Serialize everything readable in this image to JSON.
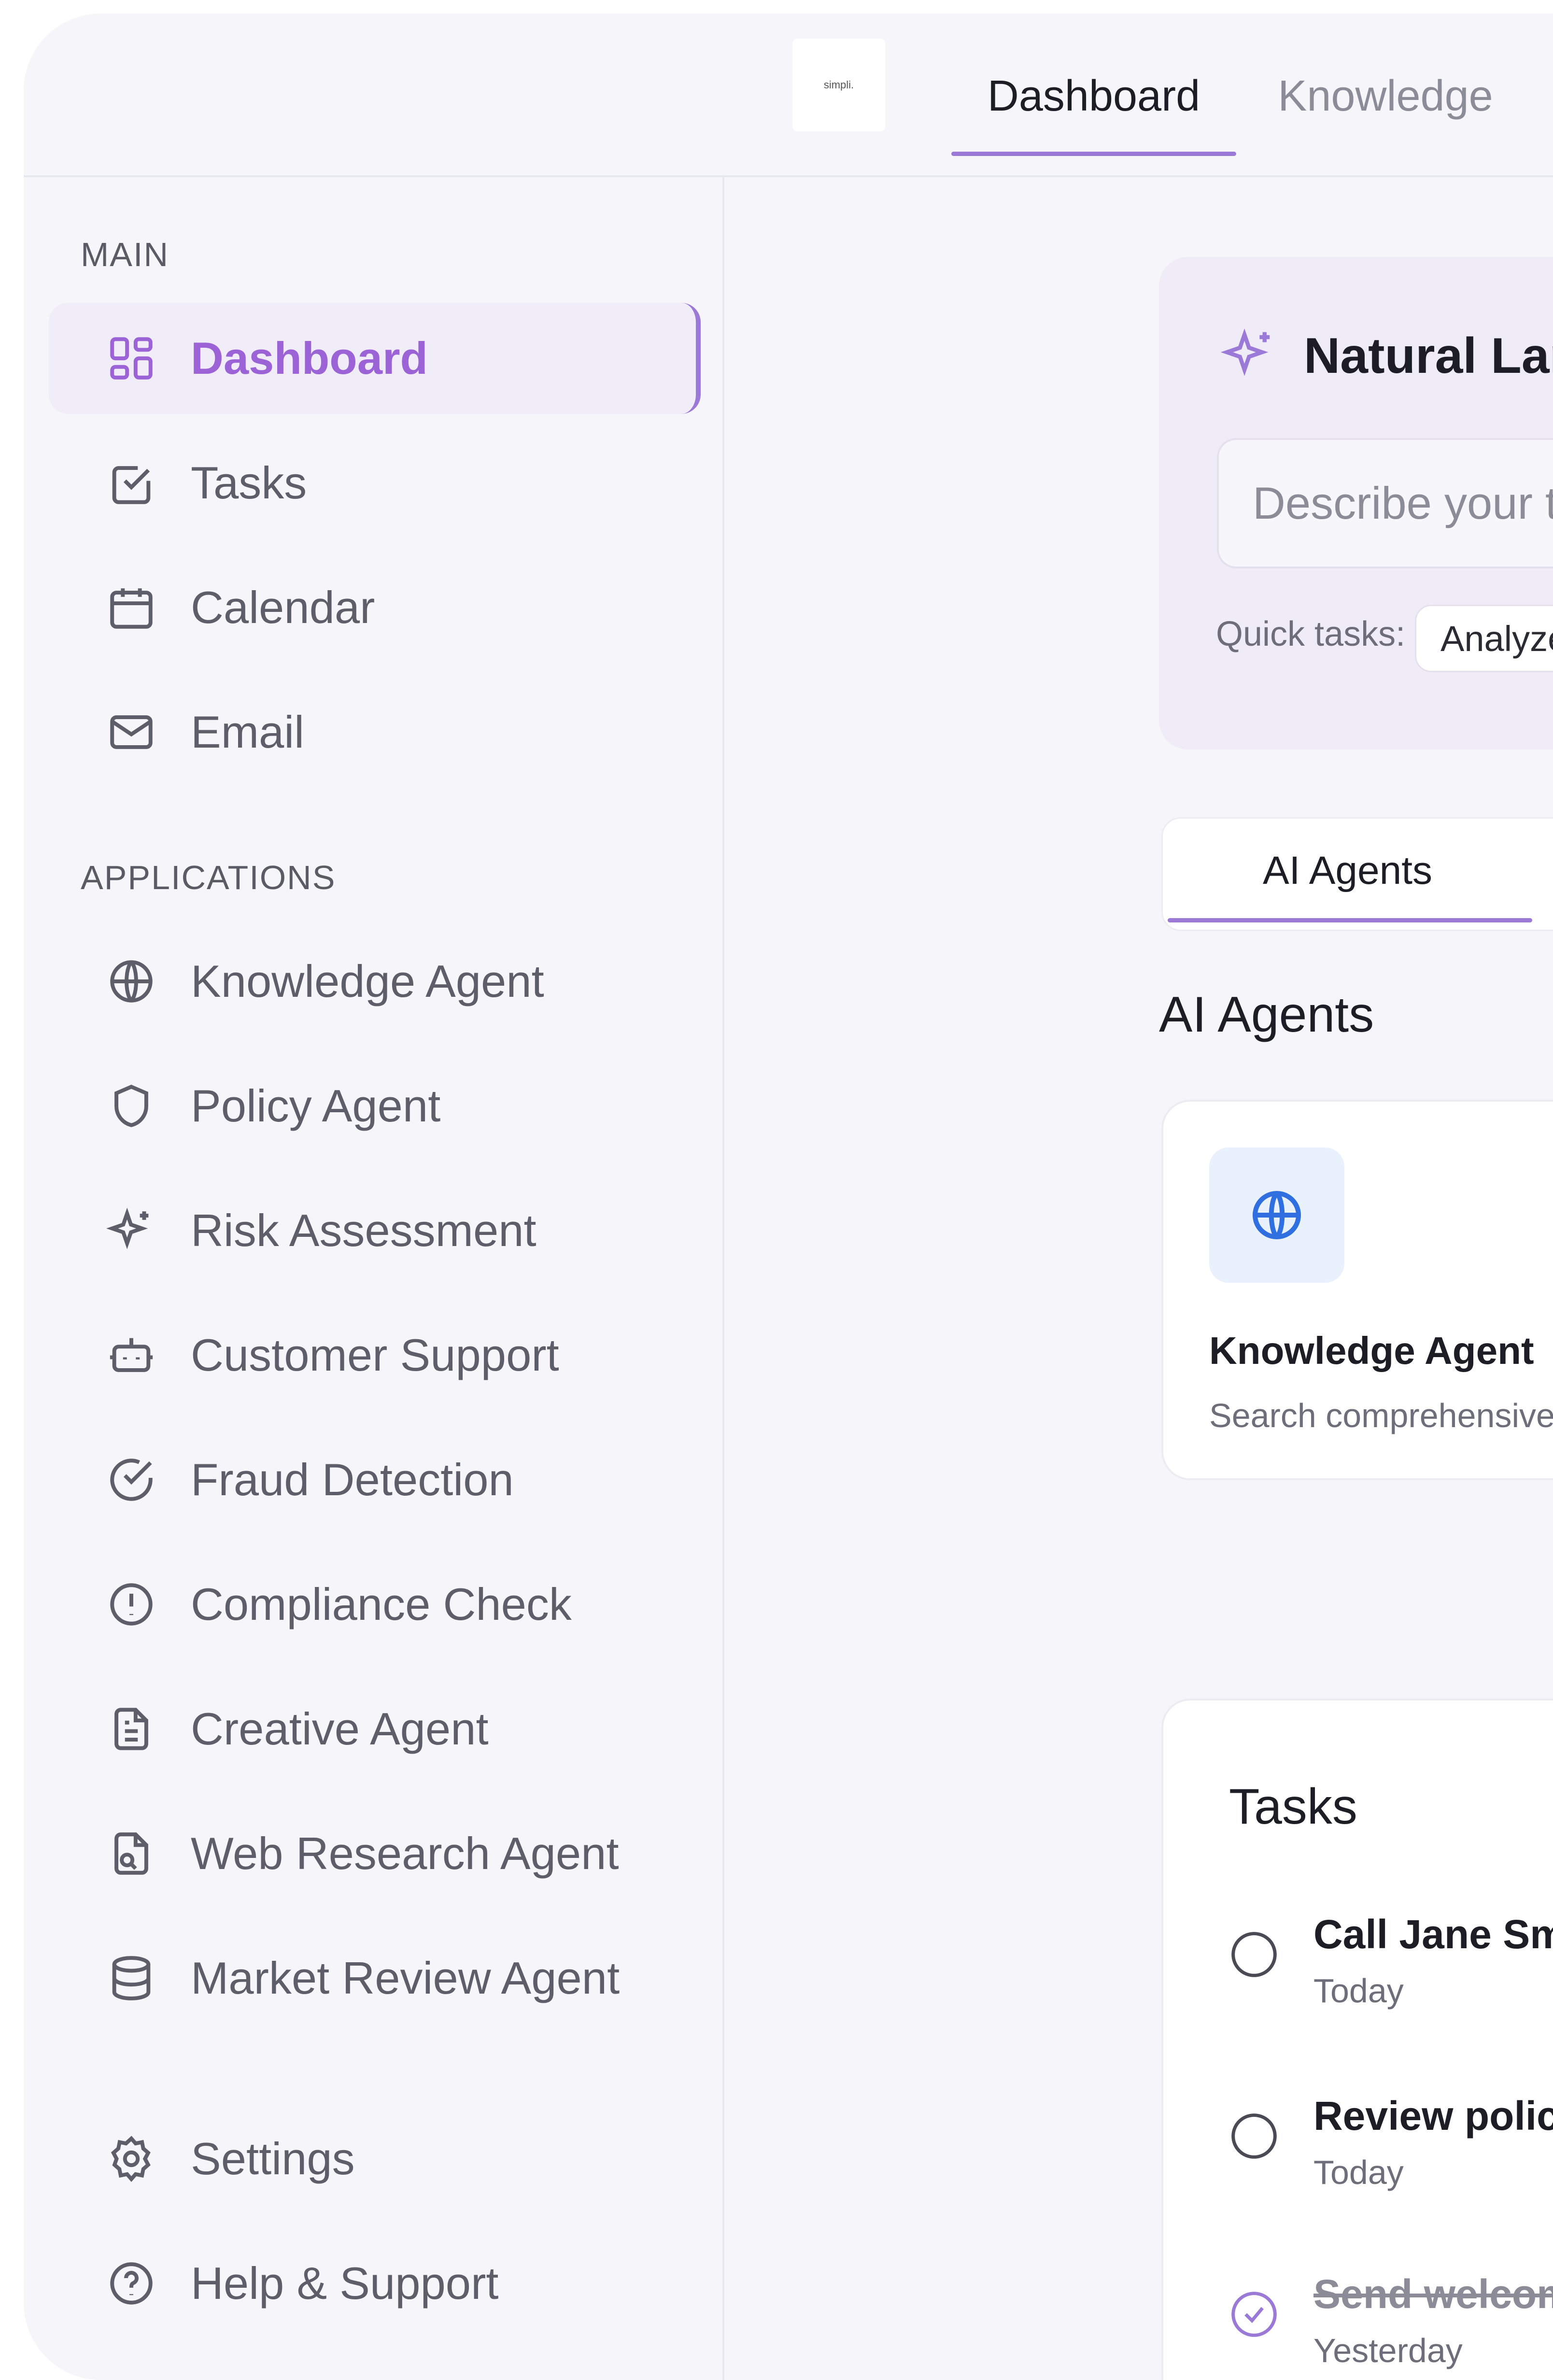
{
  "topbar": {
    "logo_text": "simpli.",
    "tabs": [
      {
        "label": "Dashboard",
        "active": true
      },
      {
        "label": "Knowledge",
        "active": false
      }
    ]
  },
  "sidebar": {
    "main_label": "MAIN",
    "main_items": [
      {
        "label": "Dashboard",
        "icon": "grid-icon",
        "active": true
      },
      {
        "label": "Tasks",
        "icon": "checkbox-icon"
      },
      {
        "label": "Calendar",
        "icon": "calendar-icon"
      },
      {
        "label": "Email",
        "icon": "mail-icon"
      }
    ],
    "apps_label": "APPLICATIONS",
    "app_items": [
      {
        "label": "Knowledge Agent",
        "icon": "globe-icon"
      },
      {
        "label": "Policy Agent",
        "icon": "shield-icon"
      },
      {
        "label": "Risk Assessment",
        "icon": "sparkle-icon"
      },
      {
        "label": "Customer Support",
        "icon": "bot-icon"
      },
      {
        "label": "Fraud Detection",
        "icon": "check-circle-icon"
      },
      {
        "label": "Compliance Check",
        "icon": "alert-circle-icon"
      },
      {
        "label": "Creative Agent",
        "icon": "document-icon"
      },
      {
        "label": "Web Research Agent",
        "icon": "file-search-icon"
      },
      {
        "label": "Market Review Agent",
        "icon": "database-icon"
      }
    ],
    "bottom_items": [
      {
        "label": "Settings",
        "icon": "gear-icon"
      },
      {
        "label": "Help & Support",
        "icon": "help-circle-icon"
      }
    ]
  },
  "main": {
    "nl_title": "Natural Lang",
    "nl_placeholder": "Describe your t",
    "quick_label": "Quick tasks:",
    "quick_chip": "Analyze",
    "tab_label": "AI Agents",
    "section_heading": "AI Agents",
    "agent_card": {
      "name": "Knowledge Agent",
      "description": "Search comprehensive",
      "icon": "globe-icon"
    },
    "tasks_title": "Tasks",
    "tasks": [
      {
        "title": "Call Jane Smit",
        "when": "Today",
        "done": false
      },
      {
        "title": "Review policy",
        "when": "Today",
        "done": false
      },
      {
        "title": "Send welcom",
        "when": "Yesterday",
        "done": true
      }
    ]
  },
  "colors": {
    "accent": "#9b79d6",
    "accent_text": "#9c63d6",
    "agent_icon": "#2f6fe0",
    "background": "#f6f6fa"
  }
}
